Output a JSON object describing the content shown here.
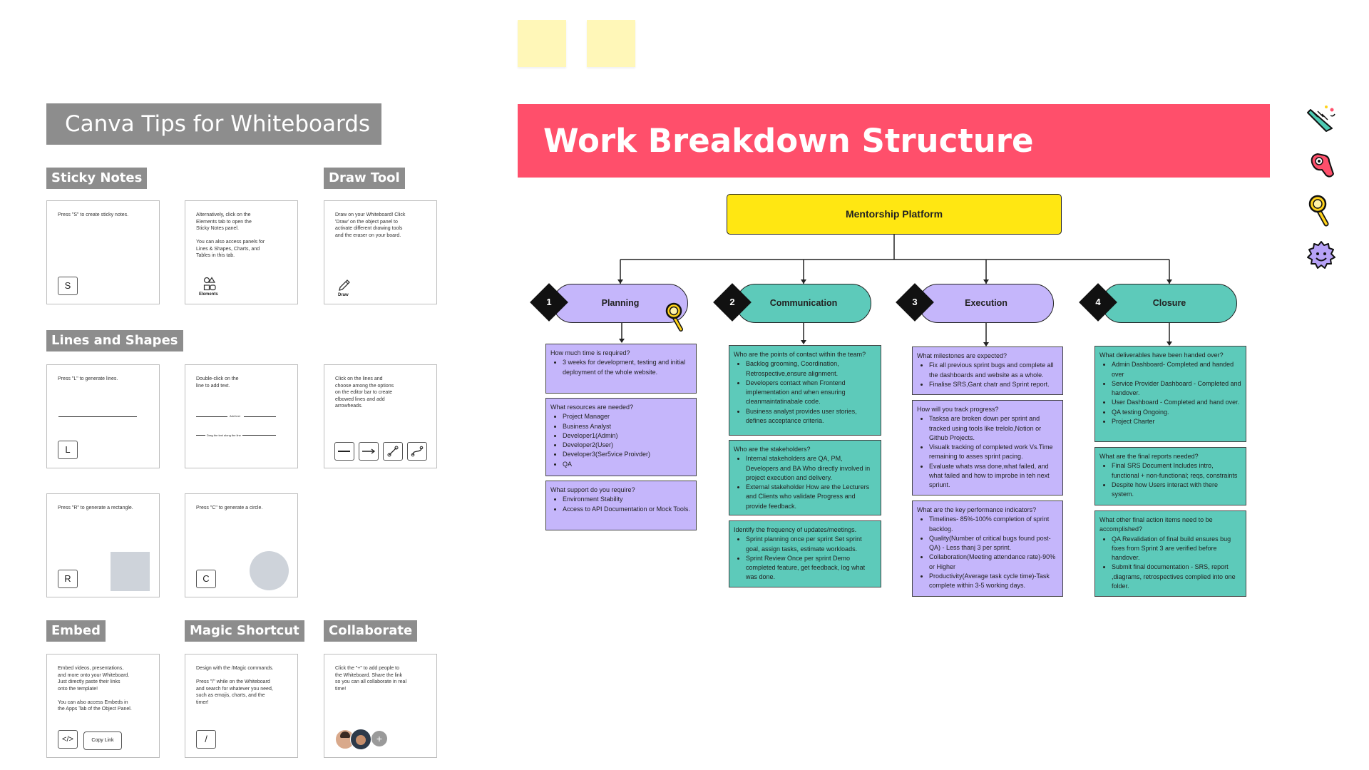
{
  "tips": {
    "title": "Canva Tips for Whiteboards",
    "sections": {
      "sticky_notes": "Sticky Notes",
      "draw_tool": "Draw Tool",
      "lines_shapes": "Lines and Shapes",
      "embed": "Embed",
      "magic_shortcut": "Magic Shortcut",
      "collaborate": "Collaborate"
    },
    "cards": {
      "sticky1_text": "Press \"S\" to create sticky notes.",
      "sticky1_key": "S",
      "sticky2_text": "Alternatively, click on the\nElements tab to open the\nSticky Notes panel.\n\nYou can also access panels for\nLines & Shapes, Charts, and\nTables in this tab.",
      "sticky2_icon_label": "Elements",
      "draw_text": "Draw on your Whiteboard! Click\n'Draw' on the object panel to\nactivate different drawing tools\nand the eraser on your board.",
      "draw_icon_label": "Draw",
      "lines1_text": "Press \"L\" to generate lines.",
      "lines1_key": "L",
      "lines2_text": "Double-click on the\nline to add text.",
      "lines2_mid_label": "Add text",
      "lines2_long_label": "Drag the text along the line",
      "lines3_text": "Click on the lines and\nchoose among the options\non the editor bar to create\nelbowed lines and add\narrowheads.",
      "rect_text": "Press \"R\" to generate a rectangle.",
      "rect_key": "R",
      "circle_text": "Press \"C\" to generate a circle.",
      "circle_key": "C",
      "embed_text": "Embed videos, presentations,\nand more onto your Whiteboard.\nJust directly paste their links\nonto the template!\n\nYou can also access Embeds in\nthe Apps Tab of the Object Panel.",
      "embed_key": "</>",
      "embed_link": "Copy Link",
      "magic_text": "Design with the /Magic commands.\n\nPress \"/\" while on the Whiteboard\nand search for whatever you need,\nsuch as emojis, charts, and the\ntimer!",
      "magic_key": "/",
      "collab_text": "Click the \"+\" to add people to\nthe Whiteboard. Share the link\nso you can all collaborate in real\ntime!",
      "collab_plus": "+"
    }
  },
  "wbs": {
    "title": "Work Breakdown Structure",
    "root": "Mentorship Platform",
    "colors": {
      "header": "#ff4f6b",
      "root": "#ffe712",
      "purple": "#c5b6fb",
      "teal": "#5dcaba"
    },
    "phases": [
      {
        "num": "1",
        "name": "Planning",
        "boxes": [
          {
            "q": "How much time is required?",
            "items": [
              "3 weeks for development, testing and initial deployment of the whole website."
            ]
          },
          {
            "q": "What resources are needed?",
            "items": [
              "Project Manager",
              "Business Analyst",
              "Developer1(Admin)",
              "Developer2(User)",
              "Developer3(Ser5vice Proivder)",
              "QA"
            ]
          },
          {
            "q": "What support do you require?",
            "items": [
              "Environment Stability",
              "Access to API Documentation or Mock Tools."
            ]
          }
        ]
      },
      {
        "num": "2",
        "name": "Communication",
        "boxes": [
          {
            "q": "Who are the points of contact within the team?",
            "items": [
              "Backlog grooming, Coordination, Retrospective,ensure alignment.",
              "Developers contact when Frontend implementation and when ensuring cleanmaintatinabale code.",
              "Business analyst provides user stories, defines acceptance criteria."
            ]
          },
          {
            "q": "Who are the stakeholders?",
            "items": [
              "Internal stakeholders are QA, PM, Developers and BA Who directly involved in project execution and delivery.",
              "External stakeholder How are the Lecturers and Clients who validate Progress and provide feedback."
            ]
          },
          {
            "q": "Identify the frequency of updates/meetings.",
            "items": [
              "Sprint planning once per sprint Set sprint goal, assign tasks, estimate workloads.",
              "Sprint Review Once per sprint Demo completed feature, get feedback, log what was done."
            ]
          }
        ]
      },
      {
        "num": "3",
        "name": "Execution",
        "boxes": [
          {
            "q": "What milestones are expected?",
            "items": [
              "Fix all previous sprint bugs and complete all the dashboards and website as a whole.",
              "Finalise SRS,Gant chatr and Sprint report."
            ]
          },
          {
            "q": "How will you track progress?",
            "items": [
              "Tasksa are broken down per sprint and tracked using tools like trelolo,Notion or Github Projects.",
              "Visualk tracking of completed work Vs.Time remaining to asses sprint pacing.",
              "Evaluate whats wsa done,what failed, and what failed and how to improbe in teh next spriunt."
            ]
          },
          {
            "q": "What are the key performance indicators?",
            "items": [
              "Timelines- 85%-100% completion of sprint backlog.",
              "Quality(Number of critical bugs found post-QA) - Less thanj 3 per sprint.",
              "Collaboration(Meeting attendance rate)-90% or Higher",
              "Productivity(Average task cycle time)-Task complete within 3-5 working days."
            ]
          }
        ]
      },
      {
        "num": "4",
        "name": "Closure",
        "boxes": [
          {
            "q": "What deliverables have been handed over?",
            "items": [
              "Admin Dashboard- Completed and handed over",
              "Service Provider Dashboard - Completed and handover.",
              "User Dashboard - Completed and hand over.",
              "QA testing Ongoing.",
              "Project Charter"
            ]
          },
          {
            "q": "What are the final reports needed?",
            "items": [
              "Final SRS Document Includes intro, functional + non-functional; reqs, constraints",
              "Despite how Users interact with there system."
            ]
          },
          {
            "q": "What other final action items need to be accomplished?",
            "items": [
              "QA Revalidation of final build ensures bug fixes from Sprint 3 are verified before handover.",
              "Submit final documentation - SRS, report ,diagrams, retrospectives complied into one folder."
            ]
          }
        ]
      }
    ]
  },
  "stickers": [
    "party-popper-icon",
    "pointing-hand-icon",
    "magnifier-icon",
    "smiley-badge-icon"
  ]
}
